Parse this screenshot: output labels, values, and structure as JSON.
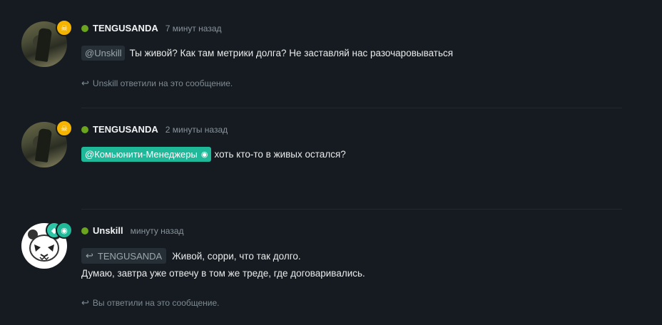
{
  "messages": [
    {
      "author": "TENGUSANDA",
      "time": "7 минут назад",
      "mention": "@Unskill",
      "text": "Ты живой? Как там метрики долга? Не заставляй нас разочаровываться",
      "replies": "Unskill ответили на это сообщение.",
      "badge_icon": "skull-icon",
      "status_color": "#6aa51d"
    },
    {
      "author": "TENGUSANDA",
      "time": "2 минуты назад",
      "mention": "@Комьюнити-Менеджеры",
      "text": "хоть кто-то в живых остался?",
      "badge_icon": "skull-icon",
      "status_color": "#6aa51d"
    },
    {
      "author": "Unskill",
      "time": "минуту назад",
      "reply_to": "TENGUSANDA",
      "text": "Живой, сорри, что так долго.",
      "text2": "Думаю, завтра уже отвечу в том же треде, где договаривались.",
      "replies": "Вы ответили на это сообщение.",
      "badge_icons": [
        "team-icon",
        "globe-icon"
      ],
      "status_color": "#6aa51d"
    }
  ],
  "colors": {
    "background": "#151b20",
    "accent": "#1fb99a",
    "badge_gold": "#f4b400"
  }
}
